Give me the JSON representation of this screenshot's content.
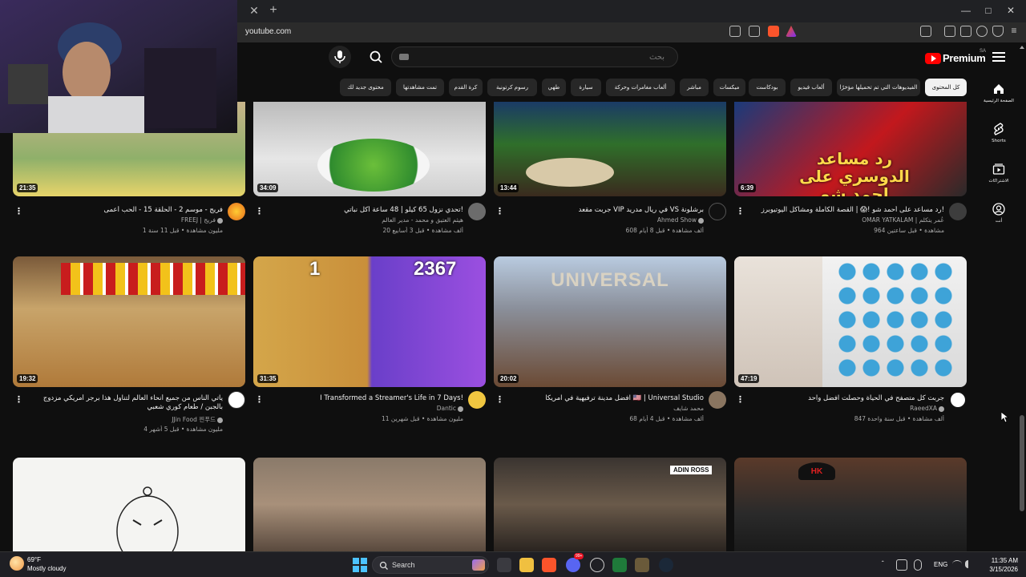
{
  "browser": {
    "url": "youtube.com",
    "new_tab_label": "+",
    "close_tab_label": "✕"
  },
  "header": {
    "search_placeholder": "بحث",
    "logo_text": "Premium",
    "logo_region": "SA"
  },
  "chips": [
    {
      "label": "كل المحتوى",
      "active": true
    },
    {
      "label": "الفيديوهات التي تم تحميلها مؤخرًا"
    },
    {
      "label": "ألعاب فيديو"
    },
    {
      "label": "بودكاست"
    },
    {
      "label": "ميكسات"
    },
    {
      "label": "مباشر"
    },
    {
      "label": "ألعاب مغامرات وحركة"
    },
    {
      "label": "سيارة"
    },
    {
      "label": "طهي"
    },
    {
      "label": "رسوم كرتونية"
    },
    {
      "label": "كرة القدم"
    },
    {
      "label": "تمت مشاهدتها"
    },
    {
      "label": "محتوى جديد لك"
    }
  ],
  "guide": [
    {
      "label": "الصفحة الرئيسية",
      "icon": "home-icon"
    },
    {
      "label": "Shorts",
      "icon": "shorts-icon"
    },
    {
      "label": "الاشتراكات",
      "icon": "subscriptions-icon"
    },
    {
      "label": "أنت",
      "icon": "you-icon"
    }
  ],
  "videos": [
    {
      "duration": "6:39",
      "title": "رد مساعد على أحمد شو !😱 | القصة الكاملة ومشاكل اليوتيوبرز!",
      "channel": "OMAR YATKALAM | عُمر يتكلم",
      "stats": "964 مشاهدة • قبل ساعتين",
      "thumb_text": "رد مساعد الدوسري على احمد شو"
    },
    {
      "duration": "13:44",
      "title": "جربت مقعد VIP في ريال مدريد VS برشلونة",
      "channel": "Ahmed Show",
      "stats": "608 ألف مشاهدة • قبل 8 أيام"
    },
    {
      "duration": "34:09",
      "title": "تحدي نزول 65 كيلو | 48 ساعة أكل نباتي!",
      "channel": "هيثم العتيق و محمد - مدير العالم",
      "stats": "20 ألف مشاهدة • قبل 3 أسابيع"
    },
    {
      "duration": "21:35",
      "title": "فريج - موسم 2 - الحلقة 15 - الحب أعمى",
      "channel": "FREEJ | فريج",
      "stats": "1 مليون مشاهدة • قبل 11 سنة"
    },
    {
      "duration": "47:19",
      "title": "جربت كل متصفح في الحياة وحصلت افضل واحد",
      "channel": "RaeedXA",
      "stats": "847 ألف مشاهدة • قبل سنة واحدة"
    },
    {
      "duration": "20:02",
      "title": "افضل مدينة ترفيهية في امريكا 🇺🇸 | Universal Studio",
      "channel": "محمد شايف",
      "stats": "68 ألف مشاهدة • قبل 4 أيام",
      "thumb_text": "UNIVERSAL"
    },
    {
      "duration": "31:35",
      "title": "I Transformed a Streamer's Life in 7 Days!",
      "channel": "Dantic",
      "stats": "11 مليون مشاهدة • قبل شهرين",
      "thumb_left": "1",
      "thumb_right": "2367"
    },
    {
      "duration": "19:32",
      "title": "يأتي الناس من جميع أنحاء العالم لتناول هذا برجر أمريكي مزدوج بالجبن / طعام كوري شعبي",
      "channel": "JJin Food 찐푸드",
      "stats": "4 مليون مشاهدة • قبل 5 أشهر"
    },
    {
      "duration": "",
      "title": "",
      "channel": "",
      "stats": ""
    },
    {
      "duration": "",
      "title": "",
      "channel": "",
      "stats": "",
      "thumb_text": "ADIN ROSS"
    },
    {
      "duration": "",
      "title": "",
      "channel": "",
      "stats": ""
    },
    {
      "duration": "",
      "title": "",
      "channel": "",
      "stats": "",
      "thumb_text": "HK"
    }
  ],
  "taskbar": {
    "temperature": "69°F",
    "weather": "Mostly cloudy",
    "search_label": "Search",
    "language": "ENG",
    "time": "11:35 AM",
    "date": "3/15/2026",
    "discord_badge": "99+"
  }
}
